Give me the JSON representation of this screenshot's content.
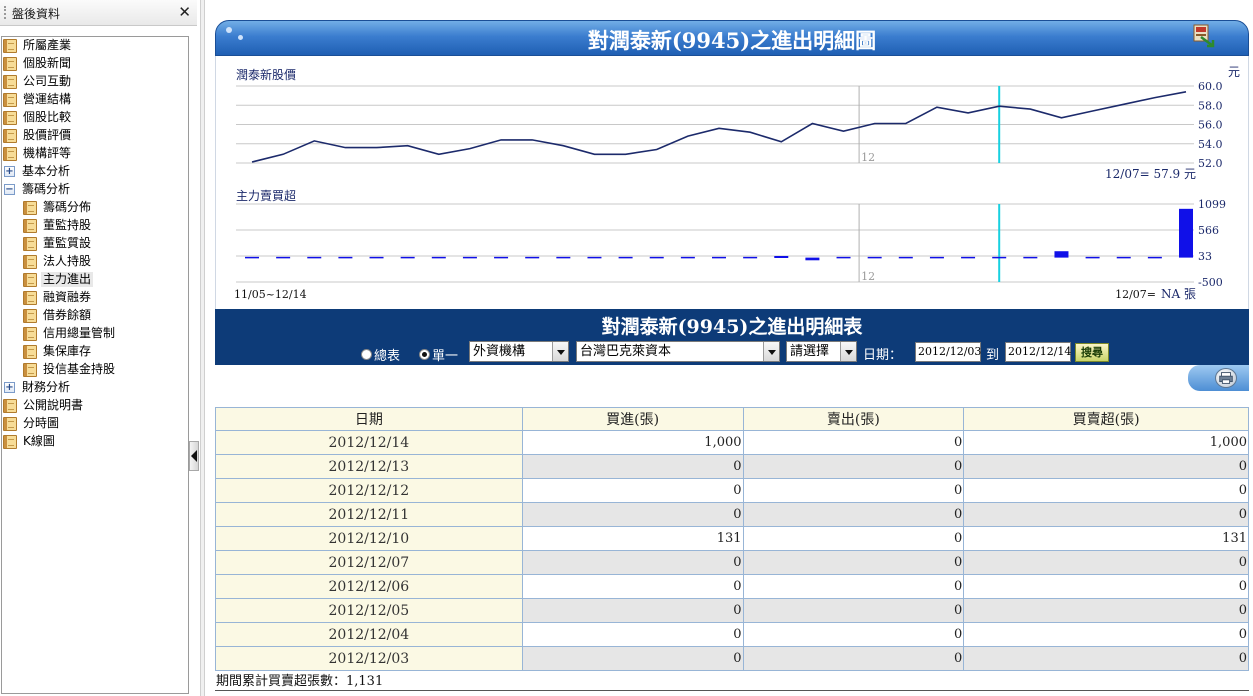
{
  "sidebar": {
    "title": "盤後資料",
    "close_glyph": "✕",
    "items": [
      {
        "label": "所屬產業",
        "icon": "book-icon",
        "level": 0
      },
      {
        "label": "個股新聞",
        "icon": "book-icon",
        "level": 0
      },
      {
        "label": "公司互動",
        "icon": "book-icon",
        "level": 0
      },
      {
        "label": "營運結構",
        "icon": "book-icon",
        "level": 0
      },
      {
        "label": "個股比較",
        "icon": "book-icon",
        "level": 0
      },
      {
        "label": "股價評價",
        "icon": "book-icon",
        "level": 0
      },
      {
        "label": "機構評等",
        "icon": "book-icon",
        "level": 0
      },
      {
        "label": "基本分析",
        "icon": "expand-icon",
        "level": 0
      },
      {
        "label": "籌碼分析",
        "icon": "collapse-icon",
        "level": 0
      },
      {
        "label": "籌碼分佈",
        "icon": "book-icon",
        "level": 1
      },
      {
        "label": "董監持股",
        "icon": "book-icon",
        "level": 1
      },
      {
        "label": "董監質設",
        "icon": "book-icon",
        "level": 1
      },
      {
        "label": "法人持股",
        "icon": "book-icon",
        "level": 1
      },
      {
        "label": "主力進出",
        "icon": "book-icon",
        "level": 1,
        "selected": true
      },
      {
        "label": "融資融券",
        "icon": "book-icon",
        "level": 1
      },
      {
        "label": "借券餘額",
        "icon": "book-icon",
        "level": 1
      },
      {
        "label": "信用總量管制",
        "icon": "book-icon",
        "level": 1
      },
      {
        "label": "集保庫存",
        "icon": "book-icon",
        "level": 1
      },
      {
        "label": "投信基金持股",
        "icon": "book-icon",
        "level": 1
      },
      {
        "label": "財務分析",
        "icon": "expand-icon",
        "level": 0
      },
      {
        "label": "公開說明書",
        "icon": "book-icon",
        "level": 0
      },
      {
        "label": "分時圖",
        "icon": "book-icon",
        "level": 0
      },
      {
        "label": "K線圖",
        "icon": "book-icon",
        "level": 0
      }
    ],
    "plus_glyph": "+",
    "minus_glyph": "−"
  },
  "chart_panel": {
    "title": "對潤泰新(9945)之進出明細圖"
  },
  "chart_data": [
    {
      "type": "line",
      "title": "潤泰新股價",
      "unit": "元",
      "y_ticks": [
        "60.0",
        "58.0",
        "56.0",
        "54.0",
        "52.0"
      ],
      "ylim": [
        52,
        60
      ],
      "x_marker_label": "12",
      "readout": "12/07=  57.9 元",
      "series": [
        {
          "values": [
            52.1,
            52.9,
            54.3,
            53.6,
            53.6,
            53.8,
            52.9,
            53.5,
            54.4,
            54.4,
            53.8,
            52.9,
            52.9,
            53.4,
            54.8,
            55.6,
            55.2,
            54.2,
            56.1,
            55.3,
            56.1,
            56.1,
            57.8,
            57.2,
            57.9,
            57.6,
            56.7,
            57.4,
            58.1,
            58.8,
            59.4
          ]
        }
      ],
      "color": "#1c2a6b",
      "highlight_color": "#18d0e0"
    },
    {
      "type": "bar",
      "title": "主力賣買超",
      "y_ticks": [
        "1099",
        "566",
        "33",
        "-500"
      ],
      "ylim": [
        -500,
        1099
      ],
      "x_marker_label": "12",
      "range_label": "11/05~12/14",
      "readout_prefix": "12/07=",
      "readout_value": "NA 張",
      "series": [
        {
          "values": [
            0,
            0,
            0,
            0,
            0,
            0,
            0,
            0,
            0,
            0,
            0,
            0,
            0,
            0,
            0,
            0,
            0,
            33,
            -55,
            0,
            0,
            0,
            0,
            0,
            0,
            0,
            131,
            0,
            0,
            0,
            1000
          ]
        }
      ],
      "color": "#1010e8"
    }
  ],
  "table_panel": {
    "title": "對潤泰新(9945)之進出明細表",
    "radio_total": "總表",
    "radio_single": "單一",
    "select_category": "外資機構",
    "select_broker": "台灣巴克萊資本",
    "select_branch": "請選擇",
    "date_label": "日期：",
    "date_from": "2012/12/03",
    "date_to_label": "到",
    "date_to": "2012/12/14",
    "search_label": "搜尋"
  },
  "table": {
    "columns": [
      "日期",
      "買進(張)",
      "賣出(張)",
      "買賣超(張)"
    ],
    "rows": [
      [
        "2012/12/14",
        "1,000",
        "0",
        "1,000"
      ],
      [
        "2012/12/13",
        "0",
        "0",
        "0"
      ],
      [
        "2012/12/12",
        "0",
        "0",
        "0"
      ],
      [
        "2012/12/11",
        "0",
        "0",
        "0"
      ],
      [
        "2012/12/10",
        "131",
        "0",
        "131"
      ],
      [
        "2012/12/07",
        "0",
        "0",
        "0"
      ],
      [
        "2012/12/06",
        "0",
        "0",
        "0"
      ],
      [
        "2012/12/05",
        "0",
        "0",
        "0"
      ],
      [
        "2012/12/04",
        "0",
        "0",
        "0"
      ],
      [
        "2012/12/03",
        "0",
        "0",
        "0"
      ]
    ]
  },
  "summary": "期間累計買賣超張數：1,131",
  "colors": {
    "header_blue": "#2f6fc6",
    "table_header_navy": "#0d3b78",
    "date_cell_bg": "#fbf9e4",
    "grid_line": "#98b5d6"
  }
}
